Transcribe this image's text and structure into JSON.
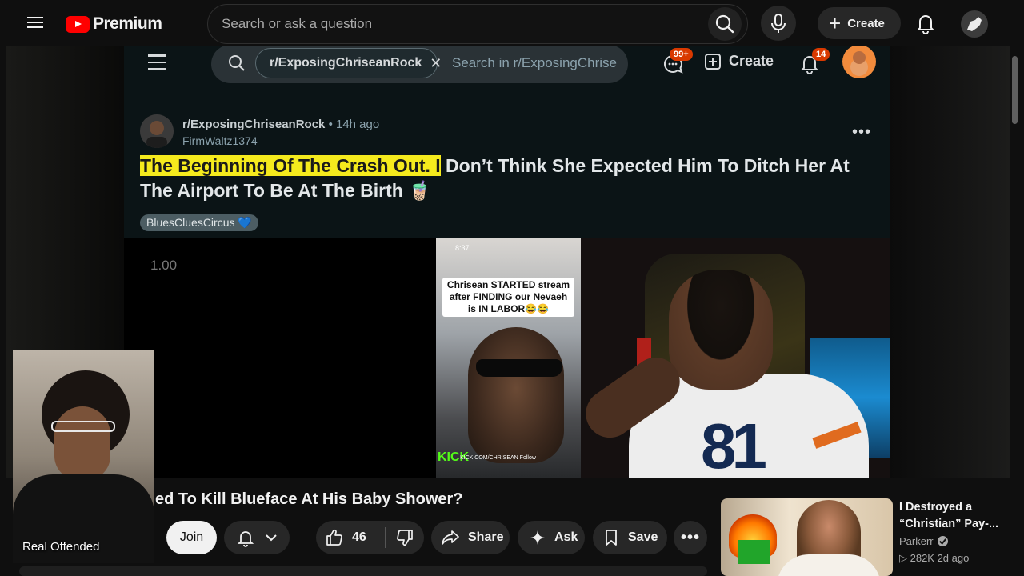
{
  "app": {
    "brand": "Premium",
    "search": {
      "placeholder": "Search or ask a question"
    },
    "create_label": "Create"
  },
  "reddit": {
    "subreddit_chip": "r/ExposingChriseanRock",
    "search_placeholder": "Search in r/ExposingChrise",
    "chat_badge": "99+",
    "create_label": "Create",
    "notif_badge": "14",
    "post": {
      "subreddit": "r/ExposingChriseanRock",
      "time": "• 14h ago",
      "user": "FirmWaltz1374",
      "title_highlight": "The Beginning Of The Crash Out. I",
      "title_rest": " Don’t Think She Expected Him To Ditch Her At The Airport To Be At The Birth 🧋",
      "flair": "BluesCluesCircus 💙"
    }
  },
  "player": {
    "speed_text": "1.00",
    "tiktok": {
      "time": "8:37",
      "caption": "Chrisean STARTED stream after FINDING our Nevaeh is IN LABOR😂😂",
      "kick": "KICK",
      "footer": "KICK.COM/CHRISEAN   Follow"
    },
    "jersey_number": "81",
    "webcam_name": "Real Offended"
  },
  "video": {
    "title": "ed To Kill Blueface At His Baby Shower?",
    "join_label": "Join",
    "like_count": "46",
    "share_label": "Share",
    "ask_label": "Ask",
    "save_label": "Save"
  },
  "recommended": {
    "title": "I Destroyed a “Christian” Pay-...",
    "channel": "Parkerr",
    "stats": "▷ 282K  2d ago"
  }
}
